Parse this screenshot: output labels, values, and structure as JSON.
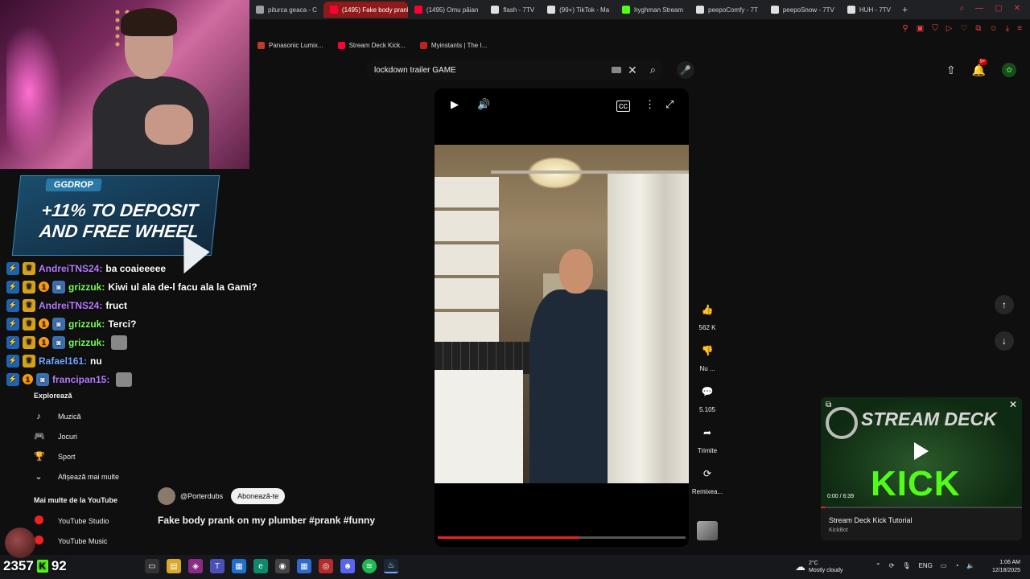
{
  "browser": {
    "tabs": [
      {
        "label": "piturca geaca - C",
        "color": "#9aa0a6",
        "active": false
      },
      {
        "label": "(1495) Fake body prank",
        "color": "#ff0033",
        "active": true
      },
      {
        "label": "(1495) Omu păian",
        "color": "#ff0033",
        "active": false
      },
      {
        "label": "flash - 7TV",
        "color": "#e0e0e0",
        "active": false
      },
      {
        "label": "(99+) TikTok - Ma",
        "color": "#e0e0e0",
        "active": false
      },
      {
        "label": "hyghman Stream",
        "color": "#53fc18",
        "active": false
      },
      {
        "label": "peepoComfy - 7T",
        "color": "#e0e0e0",
        "active": false
      },
      {
        "label": "peepoSnow - 7TV",
        "color": "#e0e0e0",
        "active": false
      },
      {
        "label": "HUH - 7TV",
        "color": "#e0e0e0",
        "active": false
      }
    ],
    "bookmarks": [
      {
        "label": "Panasonic Lumix...",
        "color": "#c0392b"
      },
      {
        "label": "Stream Deck Kick...",
        "color": "#ff0033"
      },
      {
        "label": "Myinstants | The I...",
        "color": "#b22"
      }
    ]
  },
  "youtube": {
    "search_query": "lockdown trailer GAME",
    "notifications": "9+",
    "channel_handle": "@Porterdubs",
    "subscribe_label": "Abonează-te",
    "video_title": "Fake body prank on my plumber #prank #funny",
    "progress_fraction": 0.57,
    "actions": [
      {
        "icon": "like-icon",
        "glyph": "👍",
        "label": "562 K"
      },
      {
        "icon": "dislike-icon",
        "glyph": "👎",
        "label": "Nu ..."
      },
      {
        "icon": "comment-icon",
        "glyph": "💬",
        "label": "5.105"
      },
      {
        "icon": "share-icon",
        "glyph": "➦",
        "label": "Trimite"
      },
      {
        "icon": "remix-icon",
        "glyph": "⟳",
        "label": "Remixea..."
      }
    ],
    "sidebar": {
      "explore_heading": "Explorează",
      "explore_items": [
        {
          "icon": "music-icon",
          "glyph": "♪",
          "label": "Muzică"
        },
        {
          "icon": "games-icon",
          "glyph": "🎮",
          "label": "Jocuri"
        },
        {
          "icon": "trophy-icon",
          "glyph": "🏆",
          "label": "Sport"
        },
        {
          "icon": "chevron-down-icon",
          "glyph": "⌄",
          "label": "Afișează mai multe"
        }
      ],
      "more_heading": "Mai multe de la YouTube",
      "more_items": [
        {
          "label": "YouTube Studio"
        },
        {
          "label": "YouTube Music"
        }
      ]
    },
    "miniplayer": {
      "title": "Stream Deck Kick Tutorial",
      "channel": "KickBot",
      "time": "0:00 / 6:39",
      "brand_top": "STREAM DECK",
      "brand_bottom": "KICK",
      "progress_fraction": 0.02
    }
  },
  "overlay": {
    "ggdrop": {
      "logo": "GGDROP",
      "line1": "+11% TO DEPOSIT",
      "line2": "AND FREE WHEEL"
    },
    "chat": [
      {
        "user": "AndreiTNS24:",
        "user_color": "#b77cff",
        "msg": "ba coaieeeee",
        "badges": [
          "blue",
          "gold"
        ]
      },
      {
        "user": "grizzuk:",
        "user_color": "#7cff5a",
        "msg": "Kiwi ul ala de-l facu ala la Gami?",
        "badges": [
          "blue",
          "gold",
          "orange",
          "cam"
        ]
      },
      {
        "user": "AndreiTNS24:",
        "user_color": "#b77cff",
        "msg": "fruct",
        "badges": [
          "blue",
          "gold"
        ]
      },
      {
        "user": "grizzuk:",
        "user_color": "#7cff5a",
        "msg": "Terci?",
        "badges": [
          "blue",
          "gold",
          "orange",
          "cam"
        ]
      },
      {
        "user": "grizzuk:",
        "user_color": "#7cff5a",
        "msg": "",
        "badges": [
          "blue",
          "gold",
          "orange",
          "cam"
        ],
        "emote": true
      },
      {
        "user": "Rafael161:",
        "user_color": "#6fa8ff",
        "msg": "nu",
        "badges": [
          "blue",
          "gold"
        ]
      },
      {
        "user": "francipan15:",
        "user_color": "#b77cff",
        "msg": "",
        "badges": [
          "blue",
          "orange",
          "cam"
        ],
        "emote": true
      }
    ],
    "counters": {
      "viewers": "2357",
      "kick_count": "92"
    }
  },
  "taskbar": {
    "weather_temp": "2°C",
    "weather_desc": "Mostly cloudy",
    "lang": "ENG",
    "time": "1:06 AM",
    "date": "12/18/2025"
  }
}
